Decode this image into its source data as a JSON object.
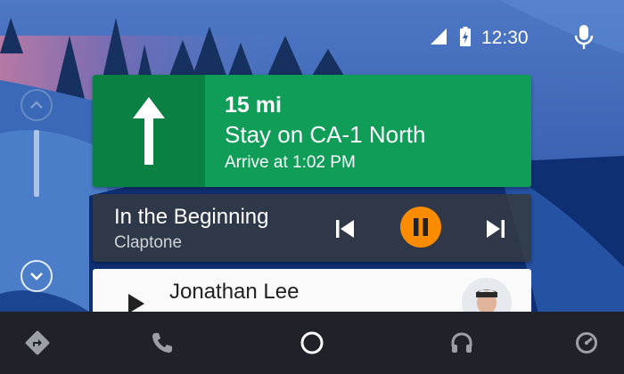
{
  "status": {
    "time": "12:30",
    "signal_icon": "cell-signal-icon",
    "battery_icon": "battery-charging-icon",
    "mic_icon": "mic-icon"
  },
  "rail": {
    "up_icon": "chevron-up-icon",
    "down_icon": "chevron-down-icon"
  },
  "navigation": {
    "direction_icon": "straight-arrow-icon",
    "distance": "15 mi",
    "instruction": "Stay on CA-1 North",
    "arrival": "Arrive at 1:02 PM",
    "color": "#0f9d58"
  },
  "media": {
    "title": "In the Beginning",
    "artist": "Claptone",
    "state": "playing",
    "accent": "#fb8c00"
  },
  "contact": {
    "name": "Jonathan Lee"
  },
  "facets": [
    {
      "name": "navigation-facet",
      "icon": "directions-icon"
    },
    {
      "name": "phone-facet",
      "icon": "phone-icon"
    },
    {
      "name": "home-facet",
      "icon": "home-circle-icon"
    },
    {
      "name": "audio-facet",
      "icon": "headphones-icon"
    },
    {
      "name": "exit-facet",
      "icon": "speedometer-icon"
    }
  ]
}
